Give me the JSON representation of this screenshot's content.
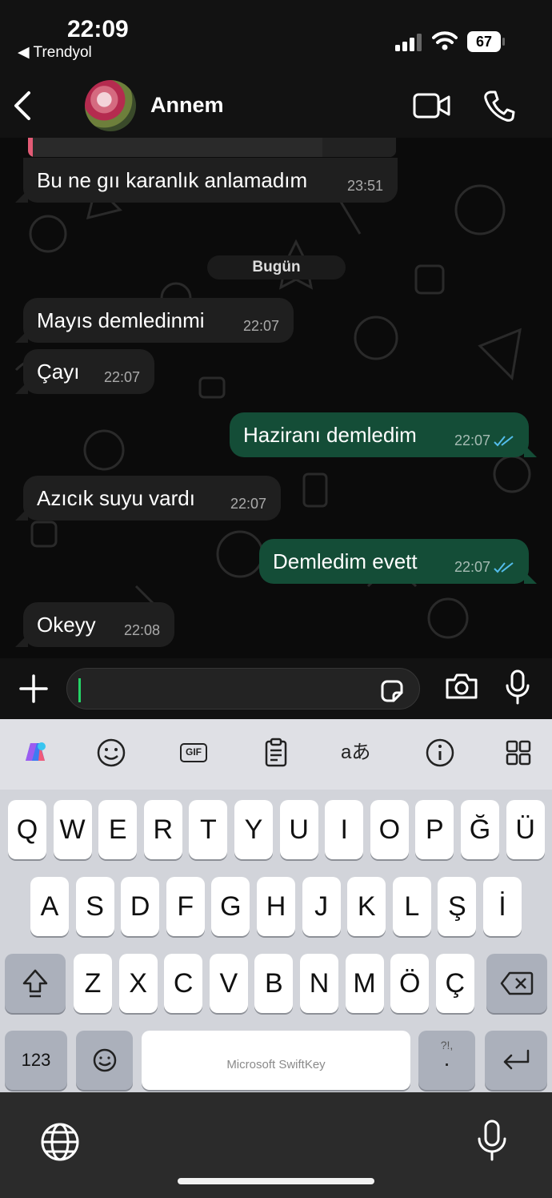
{
  "status_bar": {
    "time": "22:09",
    "back_app": "◀ Trendyol",
    "battery": "67"
  },
  "header": {
    "contact_name": "Annem",
    "icons": [
      "back-chevron-icon",
      "avatar",
      "video-call-icon",
      "voice-call-icon"
    ]
  },
  "chat": {
    "day_separator": "Bugün",
    "messages": [
      {
        "direction": "incoming",
        "text": "Bu ne gıı karanlık anlamadım",
        "time": "23:51"
      },
      {
        "direction": "incoming",
        "text": "Mayıs demledinmi",
        "time": "22:07"
      },
      {
        "direction": "incoming",
        "text": "Çayı",
        "time": "22:07"
      },
      {
        "direction": "outgoing",
        "text": "Haziranı demledim",
        "time": "22:07",
        "status": "read"
      },
      {
        "direction": "incoming",
        "text": "Azıcık suyu vardı",
        "time": "22:07"
      },
      {
        "direction": "outgoing",
        "text": "Demledim evett",
        "time": "22:07",
        "status": "read"
      },
      {
        "direction": "incoming",
        "text": "Okeyy",
        "time": "22:08"
      }
    ]
  },
  "composer": {
    "input_value": "",
    "icons": [
      "plus-icon",
      "sticker-icon",
      "camera-icon",
      "microphone-icon"
    ]
  },
  "keyboard": {
    "toolbar": [
      "copilot-icon",
      "emoji-icon",
      "gif-icon",
      "clipboard-icon",
      "translate-icon",
      "info-icon",
      "grid-icon"
    ],
    "gif_label": "GIF",
    "translate_label": "aあ",
    "row1": [
      "Q",
      "W",
      "E",
      "R",
      "T",
      "Y",
      "U",
      "I",
      "O",
      "P",
      "Ğ",
      "Ü"
    ],
    "row2": [
      "A",
      "S",
      "D",
      "F",
      "G",
      "H",
      "J",
      "K",
      "L",
      "Ş",
      "İ"
    ],
    "row3": [
      "Z",
      "X",
      "C",
      "V",
      "B",
      "N",
      "M",
      "Ö",
      "Ç"
    ],
    "numbers_label": "123",
    "space_label": "Microsoft SwiftKey",
    "punctuation_label": "?!,",
    "period_label": ".",
    "colors": {
      "outgoing_bubble": "#144d37",
      "incoming_bubble": "#1f1f1f",
      "read_ticks": "#53bdeb"
    }
  }
}
